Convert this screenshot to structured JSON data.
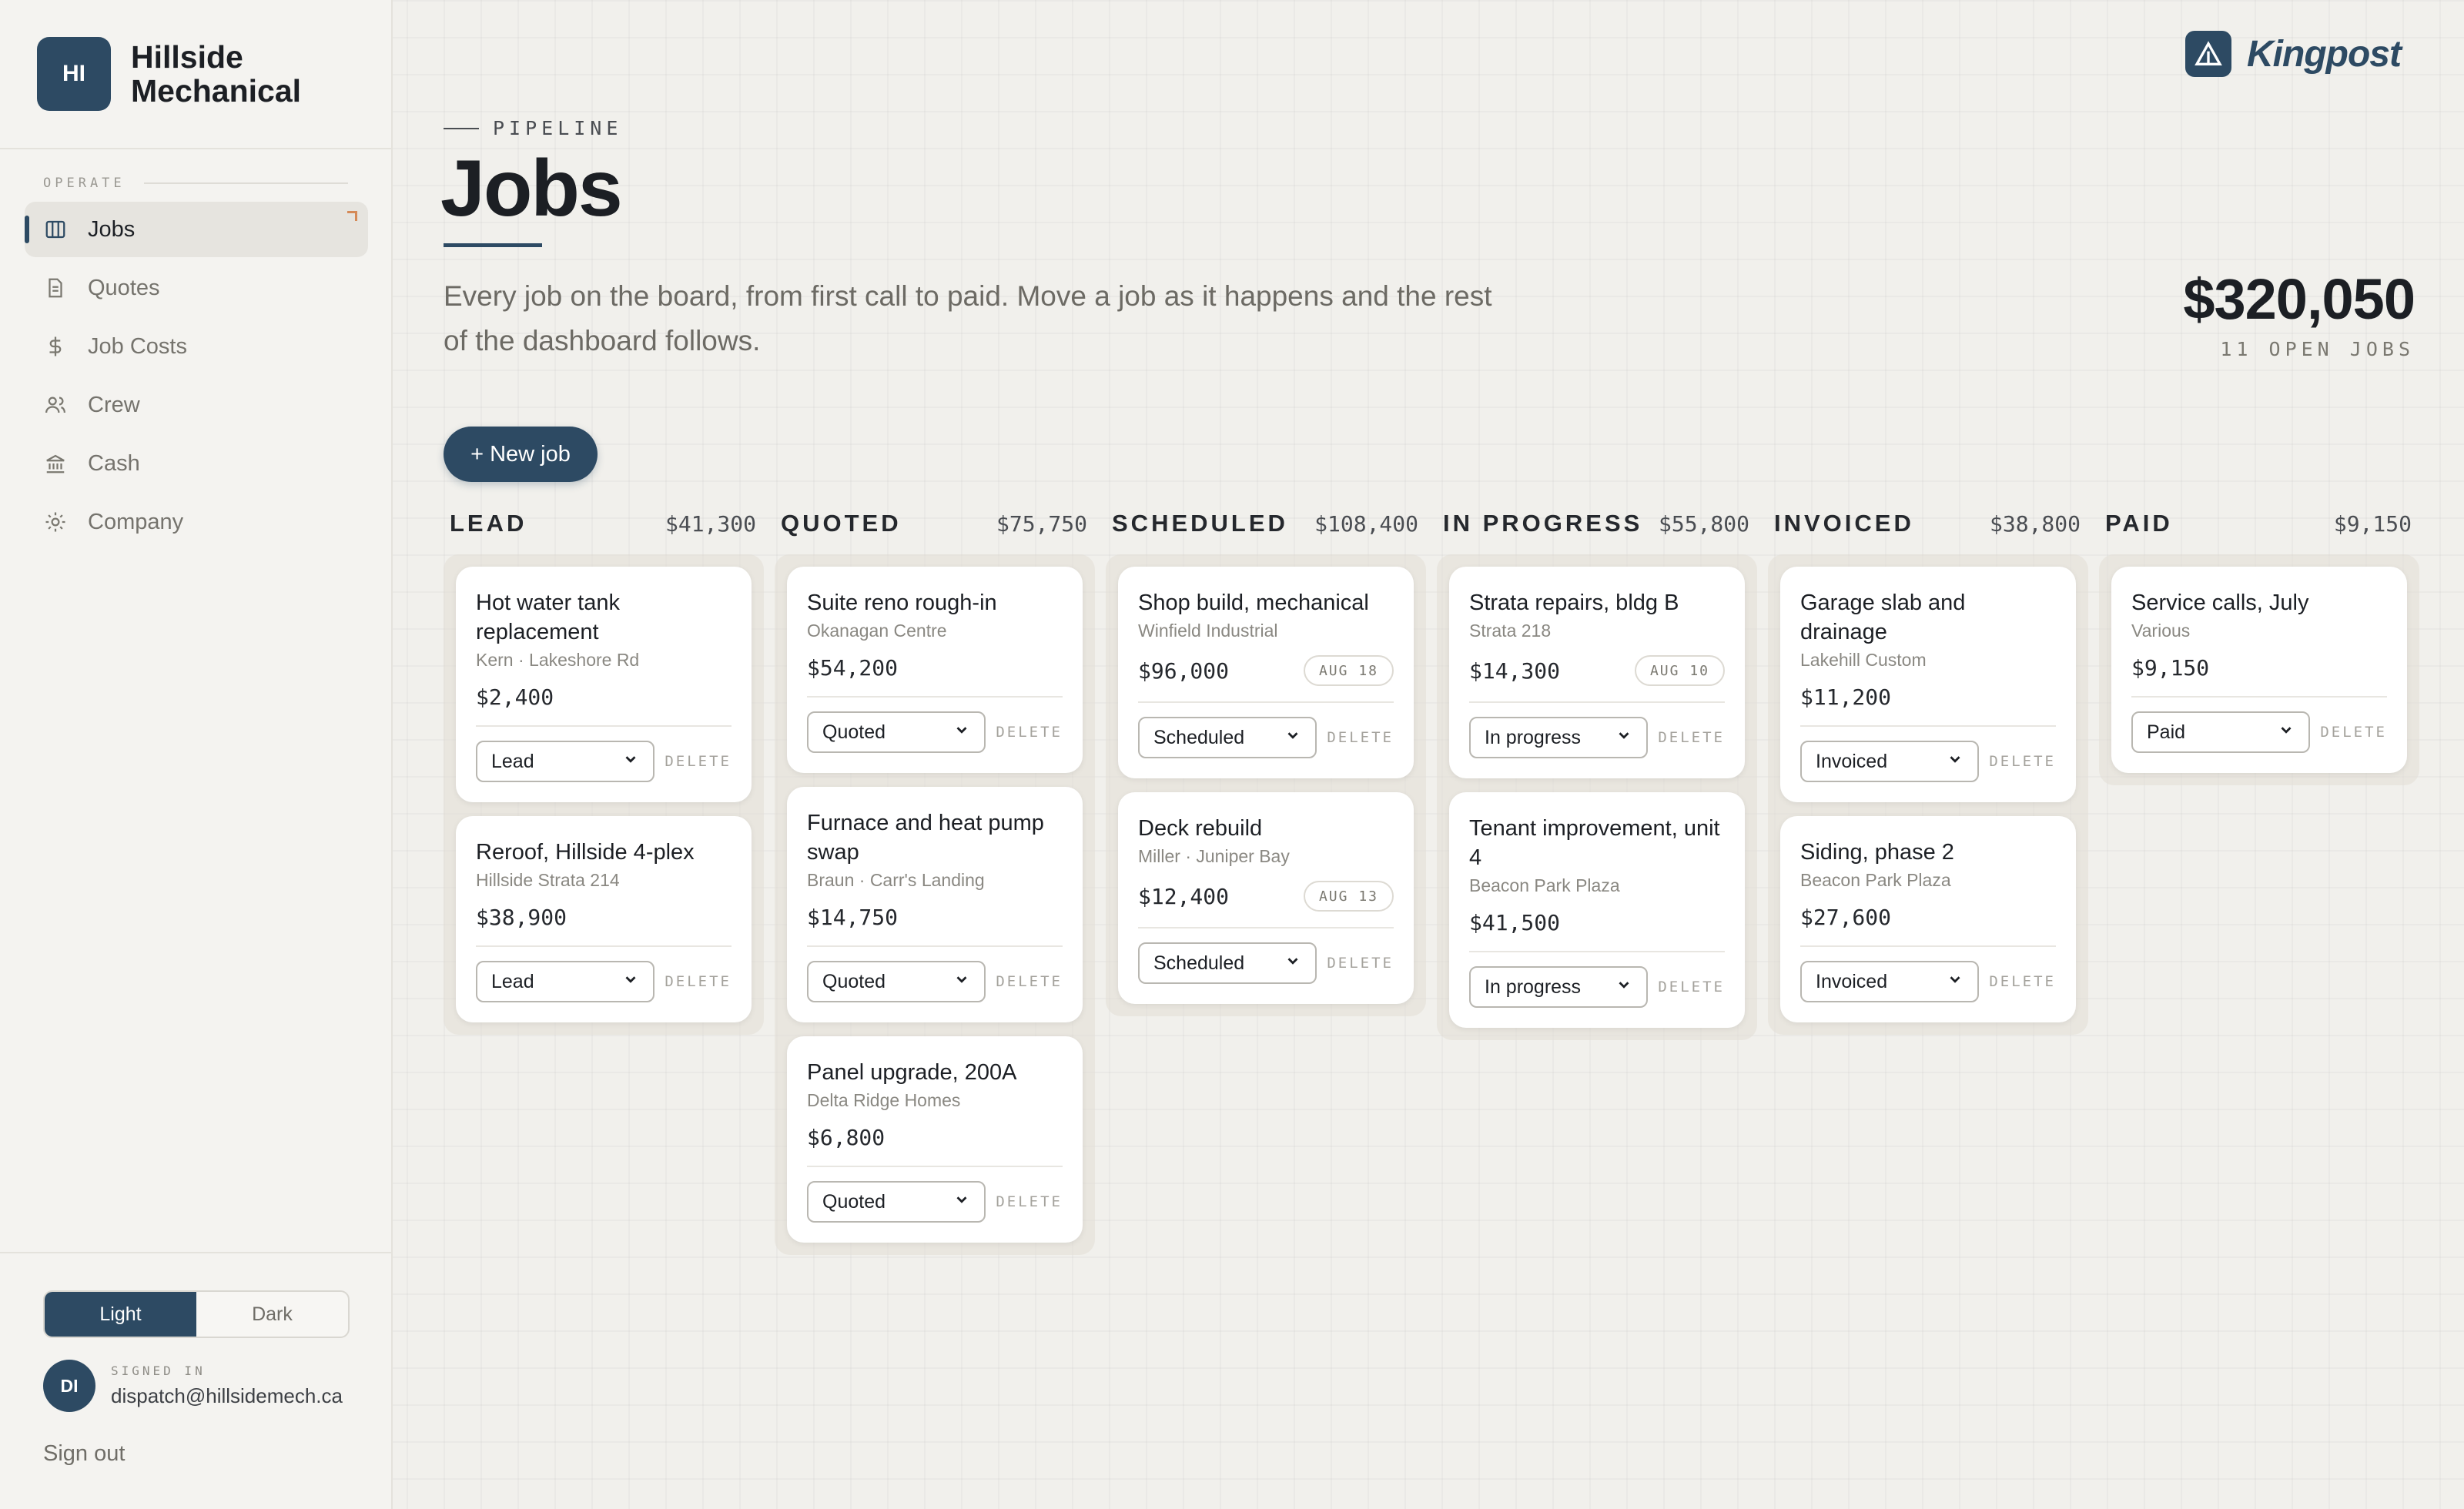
{
  "company": {
    "initials": "HI",
    "name": "Hillside Mechanical"
  },
  "nav": {
    "section_label": "OPERATE",
    "items": [
      {
        "label": "Jobs",
        "icon": "columns-icon",
        "active": true
      },
      {
        "label": "Quotes",
        "icon": "document-icon",
        "active": false
      },
      {
        "label": "Job Costs",
        "icon": "dollar-icon",
        "active": false
      },
      {
        "label": "Crew",
        "icon": "users-icon",
        "active": false
      },
      {
        "label": "Cash",
        "icon": "bank-icon",
        "active": false
      },
      {
        "label": "Company",
        "icon": "gear-icon",
        "active": false
      }
    ]
  },
  "theme": {
    "light": "Light",
    "dark": "Dark",
    "selected": "Light"
  },
  "user": {
    "initials": "DI",
    "signed_in_label": "SIGNED IN",
    "email": "dispatch@hillsidemech.ca",
    "sign_out": "Sign out"
  },
  "logo": {
    "text": "Kingpost"
  },
  "header": {
    "eyebrow": "PIPELINE",
    "title": "Jobs",
    "subtitle": "Every job on the board, from first call to paid. Move a job as it happens and the rest of the dashboard follows.",
    "total_amount": "$320,050",
    "total_label": "11 OPEN JOBS"
  },
  "actions": {
    "new_job": "+ New job",
    "delete": "DELETE"
  },
  "colors": {
    "accent": "#2d4a63",
    "background": "#f1f0ec",
    "marker": "#d58a58"
  },
  "columns": [
    {
      "title": "LEAD",
      "total": "$41,300",
      "cards": [
        {
          "title": "Hot water tank replacement",
          "client": "Kern · Lakeshore Rd",
          "amount": "$2,400",
          "date": "",
          "status": "Lead"
        },
        {
          "title": "Reroof, Hillside 4-plex",
          "client": "Hillside Strata 214",
          "amount": "$38,900",
          "date": "",
          "status": "Lead"
        }
      ]
    },
    {
      "title": "QUOTED",
      "total": "$75,750",
      "cards": [
        {
          "title": "Suite reno rough-in",
          "client": "Okanagan Centre",
          "amount": "$54,200",
          "date": "",
          "status": "Quoted"
        },
        {
          "title": "Furnace and heat pump swap",
          "client": "Braun · Carr's Landing",
          "amount": "$14,750",
          "date": "",
          "status": "Quoted"
        },
        {
          "title": "Panel upgrade, 200A",
          "client": "Delta Ridge Homes",
          "amount": "$6,800",
          "date": "",
          "status": "Quoted"
        }
      ]
    },
    {
      "title": "SCHEDULED",
      "total": "$108,400",
      "cards": [
        {
          "title": "Shop build, mechanical",
          "client": "Winfield Industrial",
          "amount": "$96,000",
          "date": "AUG 18",
          "status": "Scheduled"
        },
        {
          "title": "Deck rebuild",
          "client": "Miller · Juniper Bay",
          "amount": "$12,400",
          "date": "AUG 13",
          "status": "Scheduled"
        }
      ]
    },
    {
      "title": "IN PROGRESS",
      "total": "$55,800",
      "cards": [
        {
          "title": "Strata repairs, bldg B",
          "client": "Strata 218",
          "amount": "$14,300",
          "date": "AUG 10",
          "status": "In progress"
        },
        {
          "title": "Tenant improvement, unit 4",
          "client": "Beacon Park Plaza",
          "amount": "$41,500",
          "date": "",
          "status": "In progress"
        }
      ]
    },
    {
      "title": "INVOICED",
      "total": "$38,800",
      "cards": [
        {
          "title": "Garage slab and drainage",
          "client": "Lakehill Custom",
          "amount": "$11,200",
          "date": "",
          "status": "Invoiced"
        },
        {
          "title": "Siding, phase 2",
          "client": "Beacon Park Plaza",
          "amount": "$27,600",
          "date": "",
          "status": "Invoiced"
        }
      ]
    },
    {
      "title": "PAID",
      "total": "$9,150",
      "cards": [
        {
          "title": "Service calls, July",
          "client": "Various",
          "amount": "$9,150",
          "date": "",
          "status": "Paid"
        }
      ]
    }
  ]
}
